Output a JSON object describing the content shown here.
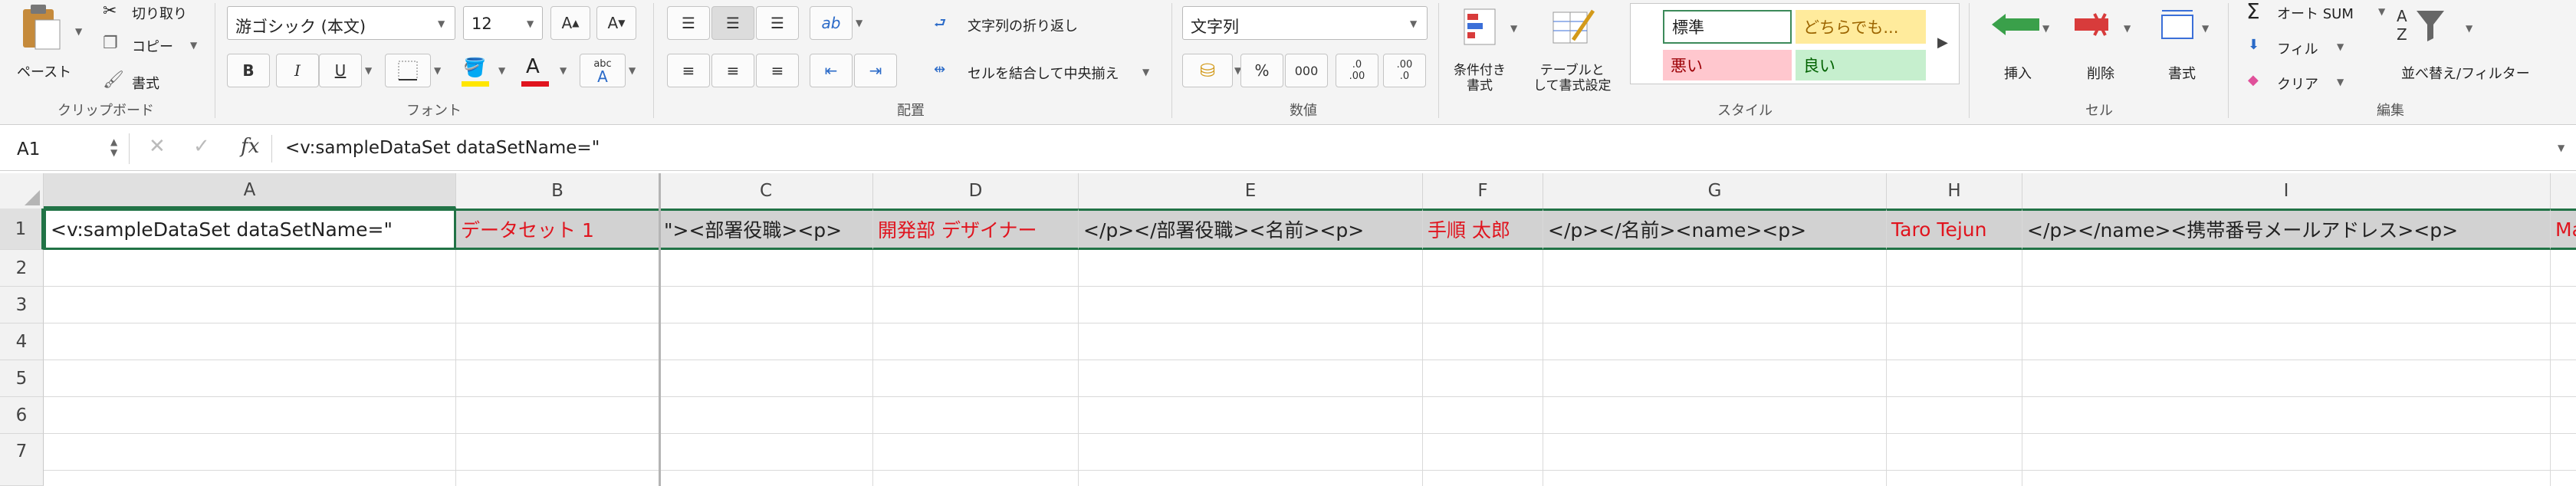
{
  "clipboard": {
    "paste_label": "ペースト",
    "cut_label": "切り取り",
    "copy_label": "コピー",
    "format_label": "書式",
    "group_label": "クリップボード"
  },
  "font": {
    "name": "游ゴシック (本文)",
    "size": "12",
    "bold": "B",
    "italic": "I",
    "underline": "U",
    "group_label": "フォント",
    "font_color": "#e0141e",
    "highlight_color": "#ffe600"
  },
  "alignment": {
    "wrap_label": "文字列の折り返し",
    "merge_label": "セルを結合して中央揃え",
    "group_label": "配置"
  },
  "number": {
    "format_value": "文字列",
    "percent": "%",
    "comma": "000",
    "inc_dec": ".0\n.00",
    "dec_dec": ".00\n.0",
    "group_label": "数値"
  },
  "styles": {
    "cond_format_label": "条件付き\n書式",
    "table_format_label": "テーブルと\nして書式設定",
    "group_label": "スタイル",
    "cells": [
      {
        "label": "標準",
        "bg": "#ffffff",
        "color": "#222222"
      },
      {
        "label": "どちらでも...",
        "bg": "#ffeb9c",
        "color": "#9c6500"
      },
      {
        "label": "悪い",
        "bg": "#ffc7ce",
        "color": "#9c0006"
      },
      {
        "label": "良い",
        "bg": "#c6efce",
        "color": "#006100"
      }
    ]
  },
  "cells_group": {
    "insert_label": "挿入",
    "delete_label": "削除",
    "format_label": "書式",
    "group_label": "セル"
  },
  "editing": {
    "autosum_label": "オート SUM",
    "fill_label": "フィル",
    "clear_label": "クリア",
    "sort_label": "並べ替え/フィルター",
    "group_label": "編集"
  },
  "formula_bar": {
    "name_box": "A1",
    "fx": "fx",
    "content": "<v:sampleDataSet  dataSetName=\""
  },
  "columns": [
    "A",
    "B",
    "C",
    "D",
    "E",
    "F",
    "G",
    "H",
    "I"
  ],
  "rows": [
    "1",
    "2",
    "3",
    "4",
    "5",
    "6",
    "7"
  ],
  "row1": [
    "<v:sampleDataSet  dataSetName=\"",
    "データセット 1",
    "\"><部署役職><p>",
    "開発部 デザイナー",
    "</p></部署役職><名前><p>",
    "手順 太郎",
    "</p></名前><name><p>",
    "Taro Tejun",
    "</p></name><携帯番号メールアドレス><p>",
    "Ma"
  ]
}
